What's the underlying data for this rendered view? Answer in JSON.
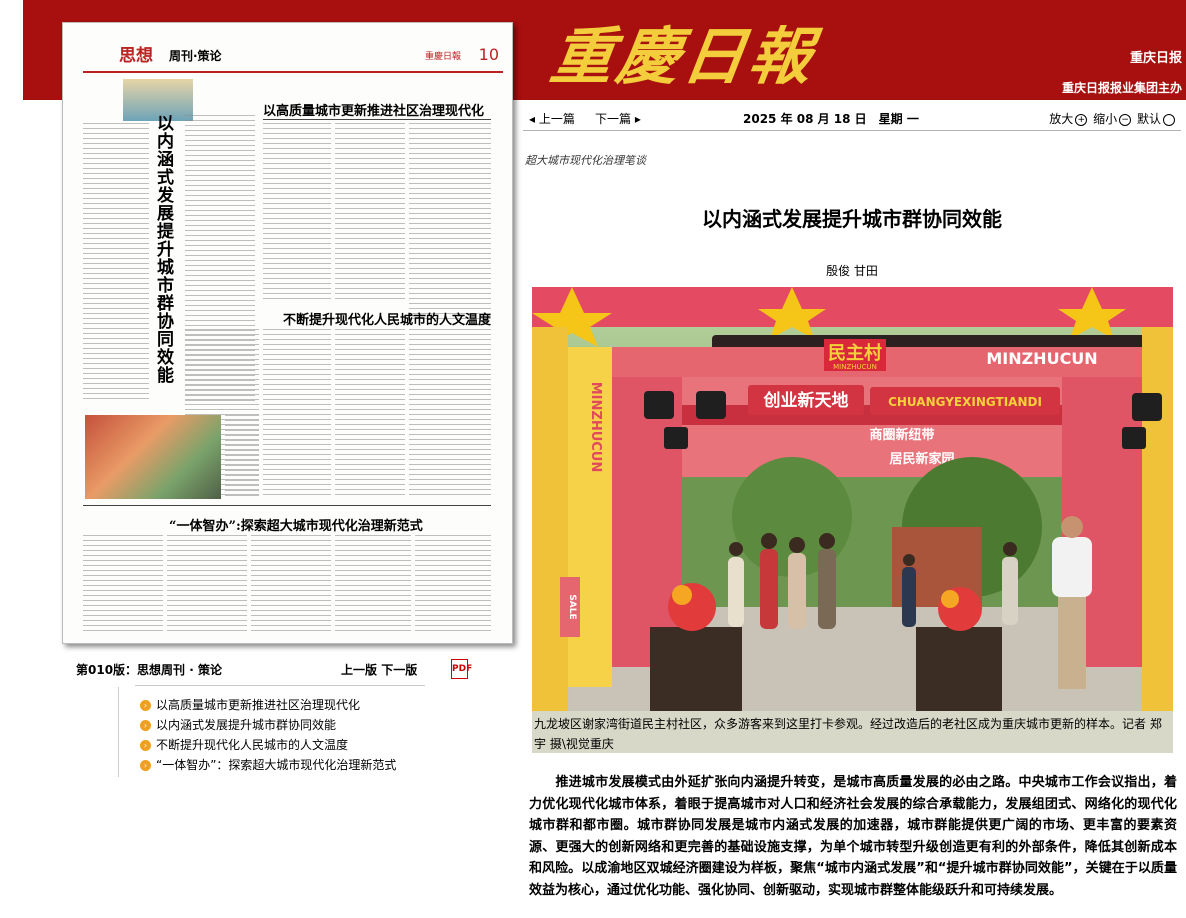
{
  "header": {
    "logo_text": "重慶日報",
    "brand_title": "重庆日报",
    "brand_host": "重庆日报报业集团主办",
    "colors": {
      "bar": "#a7100f",
      "logo": "#f3cd3b"
    }
  },
  "newspaper_thumb": {
    "section": "思想",
    "subsection": "周刊·策论",
    "page_number": "10",
    "masthead": "重慶日報",
    "vertical_title": "以内涵式发展提升城市群协同效能",
    "headline_1": "以高质量城市更新推进社区治理现代化",
    "headline_2": "不断提升现代化人民城市的人文温度",
    "headline_3": "“一体智办”:探索超大城市现代化治理新范式"
  },
  "edition": {
    "label": "第010版：思想周刊 · 策论",
    "prev_page": "上一版",
    "next_page": "下一版",
    "pdf_icon": "pdf-icon",
    "articles": [
      "以高质量城市更新推进社区治理现代化",
      "以内涵式发展提升城市群协同效能",
      "不断提升现代化人民城市的人文温度",
      "“一体智办”：探索超大城市现代化治理新范式"
    ]
  },
  "nav": {
    "prev": "上一篇",
    "next": "下一篇",
    "date": "2025 年 08 月 18 日　星期 一",
    "zoom_in": "放大",
    "zoom_out": "缩小",
    "default": "默认"
  },
  "article": {
    "kicker": "超大城市现代化治理笔谈",
    "title": "以内涵式发展提升城市群协同效能",
    "author": "殷俊  甘田",
    "photo_caption": "九龙坡区谢家湾街道民主村社区，众多游客来到这里打卡参观。经过改造后的老社区成为重庆城市更新的样本。记者 郑宇 摄\\视觉重庆",
    "photo_signs": {
      "main": "民主村",
      "main_pinyin": "MINZHUCUN",
      "vertical": "MINZHUCUN",
      "sub": "创业新天地",
      "sub_pinyin": "CHUANGYEXINGTIANDI",
      "row3": "商圈新纽带",
      "row4": "居民新家园",
      "sale": "SALE"
    },
    "body": "　　推进城市发展模式由外延扩张向内涵提升转变，是城市高质量发展的必由之路。中央城市工作会议指出，着力优化现代化城市体系，着眼于提高城市对人口和经济社会发展的综合承载能力，发展组团式、网络化的现代化城市群和都市圈。城市群协同发展是城市内涵式发展的加速器，城市群能提供更广阔的市场、更丰富的要素资源、更强大的创新网络和更完善的基础设施支撑，为单个城市转型升级创造更有利的外部条件，降低其创新成本和风险。以成渝地区双城经济圈建设为样板，聚焦“城市内涵式发展”和“提升城市群协同效能”，关键在于以质量效益为核心，通过优化功能、强化协同、创新驱动，实现城市群整体能级跃升和可持续发展。"
  }
}
